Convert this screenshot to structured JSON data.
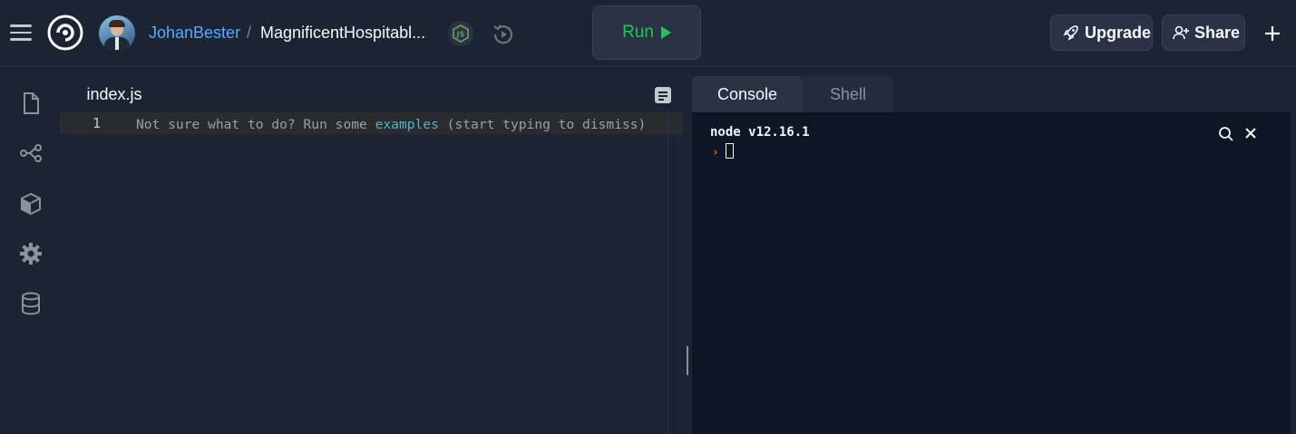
{
  "header": {
    "username": "JohanBester",
    "separator": "/",
    "repl_name": "MagnificentHospitabl...",
    "run_label": "Run",
    "upgrade_label": "Upgrade",
    "share_label": "Share"
  },
  "sidebar": {
    "items": [
      {
        "name": "files",
        "icon": "file-icon"
      },
      {
        "name": "version-control",
        "icon": "git-icon"
      },
      {
        "name": "packages",
        "icon": "package-icon"
      },
      {
        "name": "settings",
        "icon": "gear-icon"
      },
      {
        "name": "database",
        "icon": "database-icon"
      }
    ]
  },
  "editor": {
    "tab_label": "index.js",
    "line_number": "1",
    "placeholder_prefix": "Not sure what to do? Run some ",
    "placeholder_link": "examples",
    "placeholder_suffix": " (start typing to dismiss)"
  },
  "panel": {
    "console_tab": "Console",
    "shell_tab": "Shell",
    "console_output": "node v12.16.1",
    "prompt": "›"
  },
  "colors": {
    "background": "#1c2333",
    "console_bg": "#0e1525",
    "accent_blue": "#57abff",
    "run_green": "#1fc55c",
    "prompt_orange": "#f26522",
    "link_cyan": "#4eb3d3"
  }
}
